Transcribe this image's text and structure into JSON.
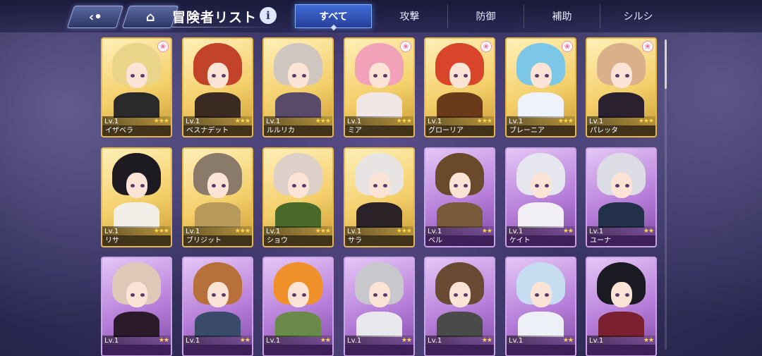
{
  "header": {
    "title": "冒険者リスト",
    "back_icon": "back-arrow-icon",
    "home_icon": "home-icon",
    "info_label": "i"
  },
  "tabs": [
    {
      "label": "すべて",
      "active": true
    },
    {
      "label": "攻撃",
      "active": false
    },
    {
      "label": "防御",
      "active": false
    },
    {
      "label": "補助",
      "active": false
    },
    {
      "label": "シルシ",
      "active": false
    }
  ],
  "level_prefix": "Lv.",
  "cards": [
    {
      "name": "イザベラ",
      "level": "Lv.1",
      "stars": "★★★",
      "rarity": "gold",
      "hair": "#e9d48a",
      "outfit": "#2a2a2a",
      "badge": true
    },
    {
      "name": "ベスナデット",
      "level": "Lv.1",
      "stars": "★★★",
      "rarity": "gold",
      "hair": "#c2432a",
      "outfit": "#3b2a22",
      "badge": false
    },
    {
      "name": "ルルリカ",
      "level": "Lv.1",
      "stars": "★★★",
      "rarity": "gold",
      "hair": "#cfc6c0",
      "outfit": "#5a4a6a",
      "badge": false
    },
    {
      "name": "ミア",
      "level": "Lv.1",
      "stars": "★★★",
      "rarity": "gold",
      "hair": "#f2a2b8",
      "outfit": "#f0e6e6",
      "badge": true
    },
    {
      "name": "グローリア",
      "level": "Lv.1",
      "stars": "★★★",
      "rarity": "gold",
      "hair": "#d8452a",
      "outfit": "#6a3a1a",
      "badge": true
    },
    {
      "name": "ブレーニア",
      "level": "Lv.1",
      "stars": "★★★",
      "rarity": "gold",
      "hair": "#7cc6e8",
      "outfit": "#eef2fa",
      "badge": true
    },
    {
      "name": "パレッタ",
      "level": "Lv.1",
      "stars": "★★★",
      "rarity": "gold",
      "hair": "#d8b08a",
      "outfit": "#2a2030",
      "badge": true
    },
    {
      "name": "リサ",
      "level": "Lv.1",
      "stars": "★★★",
      "rarity": "gold",
      "hair": "#1e1a22",
      "outfit": "#f2efe8",
      "badge": false
    },
    {
      "name": "ブリジット",
      "level": "Lv.1",
      "stars": "★★★",
      "rarity": "gold",
      "hair": "#8a7a6a",
      "outfit": "#b89a5a",
      "badge": false
    },
    {
      "name": "ショウ",
      "level": "Lv.1",
      "stars": "★★★",
      "rarity": "gold",
      "hair": "#ddd0c8",
      "outfit": "#4a6a2a",
      "badge": false
    },
    {
      "name": "サラ",
      "level": "Lv.1",
      "stars": "★★★",
      "rarity": "gold",
      "hair": "#e8e4e4",
      "outfit": "#2a2226",
      "badge": false
    },
    {
      "name": "ベル",
      "level": "Lv.1",
      "stars": "★★",
      "rarity": "purple",
      "hair": "#6a4a2a",
      "outfit": "#7a5a3a",
      "badge": false
    },
    {
      "name": "ケイト",
      "level": "Lv.1",
      "stars": "★★",
      "rarity": "purple",
      "hair": "#e6e6ee",
      "outfit": "#f2eef6",
      "badge": false
    },
    {
      "name": "ユーナ",
      "level": "Lv.1",
      "stars": "★★",
      "rarity": "purple",
      "hair": "#dcdce4",
      "outfit": "#22304a",
      "badge": false
    },
    {
      "name": "",
      "level": "Lv.1",
      "stars": "★★",
      "rarity": "purple",
      "hair": "#e0c8b8",
      "outfit": "#2a1a2a",
      "badge": false
    },
    {
      "name": "",
      "level": "Lv.1",
      "stars": "★★",
      "rarity": "purple",
      "hair": "#b8703a",
      "outfit": "#3a4a6a",
      "badge": false
    },
    {
      "name": "",
      "level": "Lv.1",
      "stars": "★★",
      "rarity": "purple",
      "hair": "#f0902a",
      "outfit": "#6a8a4a",
      "badge": false
    },
    {
      "name": "",
      "level": "Lv.1",
      "stars": "★★",
      "rarity": "purple",
      "hair": "#c8c8cc",
      "outfit": "#e8e8ee",
      "badge": false
    },
    {
      "name": "",
      "level": "Lv.1",
      "stars": "★★",
      "rarity": "purple",
      "hair": "#6a4a32",
      "outfit": "#4a4a4a",
      "badge": false
    },
    {
      "name": "",
      "level": "Lv.1",
      "stars": "★★",
      "rarity": "purple",
      "hair": "#c6dcf0",
      "outfit": "#eef0f8",
      "badge": false
    },
    {
      "name": "",
      "level": "Lv.1",
      "stars": "★★",
      "rarity": "purple",
      "hair": "#1a1a22",
      "outfit": "#7a2030",
      "badge": false
    }
  ],
  "colors": {
    "tab_active": "#3e6bd6",
    "gold_card": "#f4cf6a",
    "purple_card": "#b77ed9",
    "star": "#ffd84a"
  }
}
